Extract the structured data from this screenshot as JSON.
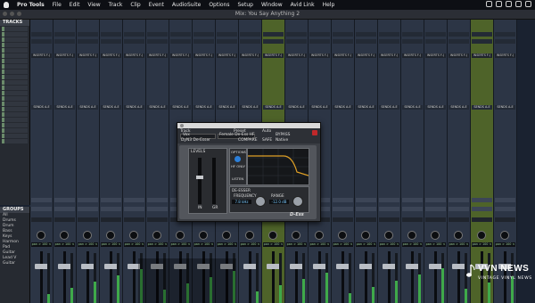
{
  "menubar": {
    "app": "Pro Tools",
    "items": [
      "File",
      "Edit",
      "View",
      "Track",
      "Clip",
      "Event",
      "AudioSuite",
      "Options",
      "Setup",
      "Window",
      "Avid Link",
      "Help"
    ]
  },
  "window": {
    "title": "Mix: You Say Anything 2"
  },
  "tracks_panel": {
    "title": "TRACKS"
  },
  "groups_panel": {
    "title": "GROUPS",
    "items": [
      "All",
      "Drums",
      "Drum",
      "Bass",
      "Keys",
      "Harmon",
      "Pad",
      "Guitar",
      "Lead V",
      "Guitar"
    ]
  },
  "mixer": {
    "insert_label": "INSERTS F-J",
    "sends_label": "SENDS A-E",
    "pan_label": "pan > 100 <",
    "strip_count": 21,
    "green_strips": [
      10,
      19
    ]
  },
  "plugin": {
    "header": {
      "track_label": "Track",
      "preset_label": "Preset",
      "auto_label": "Auto",
      "track_value": "Vox",
      "preset_value": "Female De-Ess HF",
      "bypass": "BYPASS",
      "compare": "COMPARE",
      "safe": "SAFE",
      "plugin_name": "DyN3 De-Esser",
      "native": "Native"
    },
    "levels_title": "LEVELS",
    "options_title": "OPTIONS",
    "options": [
      "HF ONLY",
      "LISTEN"
    ],
    "deesser_title": "DE-ESSER",
    "frequency_label": "FREQUENCY",
    "frequency_value": "7.8 kHz",
    "range_label": "RANGE",
    "range_value": "-12.0 dB",
    "meters": [
      "IN",
      "GR"
    ],
    "brand": "D-Ess"
  },
  "watermark": {
    "title": "VVN NEWS",
    "subtitle": "VINTAGE VINYL NEWS"
  },
  "colors": {
    "accent": "#2c7fd9",
    "strip": "#2c3545",
    "strip_green": "#4e6329",
    "close": "#c0282a"
  }
}
